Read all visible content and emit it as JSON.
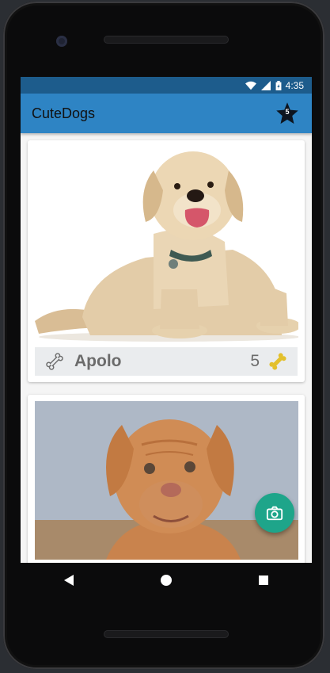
{
  "status": {
    "time": "4:35"
  },
  "app": {
    "title": "CuteDogs",
    "favorites_count": "5"
  },
  "cards": [
    {
      "name": "Apolo",
      "bones": "5"
    }
  ],
  "colors": {
    "appbar": "#2e84c4",
    "statusbar": "#1d5c8c",
    "fab": "#1ea58a",
    "bone_active": "#e3c02c"
  },
  "icons": {
    "favorites": "star-icon",
    "fab": "camera-icon",
    "nav": [
      "back-icon",
      "home-icon",
      "recents-icon"
    ]
  }
}
